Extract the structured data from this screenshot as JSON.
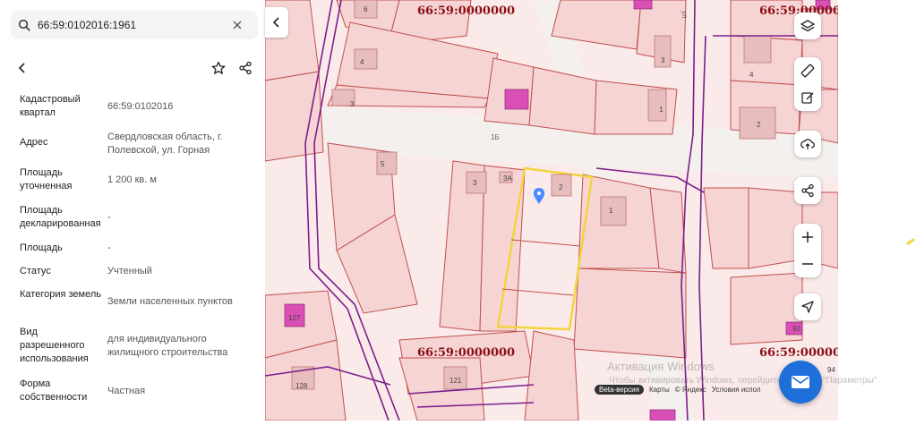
{
  "search": {
    "value": "66:59:0102016:1961"
  },
  "info": [
    {
      "key": "Кадастровый квартал",
      "value": "66:59:0102016"
    },
    {
      "key": "Адрес",
      "value": "Свердловская область, г. Полевской, ул. Горная"
    },
    {
      "key": "Площадь уточненная",
      "value": "1 200 кв. м"
    },
    {
      "key": "Площадь декларированная",
      "value": "-"
    },
    {
      "key": "Площадь",
      "value": "-"
    },
    {
      "key": "Статус",
      "value": "Учтенный"
    },
    {
      "key": "Категория земель",
      "value": "Земли населенных пунктов"
    },
    {
      "key": "Вид разрешенного использования",
      "value": "для индивидуального жилищного строительства"
    },
    {
      "key": "Форма собственности",
      "value": "Частная"
    }
  ],
  "map": {
    "quarter_labels": [
      "66:59:0000000",
      "66:59:0000000",
      "66:59:0000000",
      "66:59:0000000"
    ],
    "house_numbers": [
      "6",
      "4",
      "3",
      "5",
      "3",
      "3А",
      "2",
      "1",
      "4",
      "2",
      "1",
      "127",
      "128",
      "121",
      "3",
      "92",
      "94"
    ],
    "street_labels": [
      "1Б",
      "ул"
    ],
    "colors": {
      "parcel_fill": "#f6d4d4",
      "parcel_line": "#c0504d",
      "boundary": "#7a1f8c",
      "selected": "#f2d53c",
      "building": "#d94fb5"
    }
  },
  "attribution": {
    "beta": "Beta-версия",
    "maps": "Карты",
    "yandex": "© Яндекс",
    "terms": "Условия испол"
  },
  "watermark": {
    "line1": "Активация Windows",
    "line2": "Чтобы активировать Windows, перейдите в раздел \"Параметры\"."
  }
}
